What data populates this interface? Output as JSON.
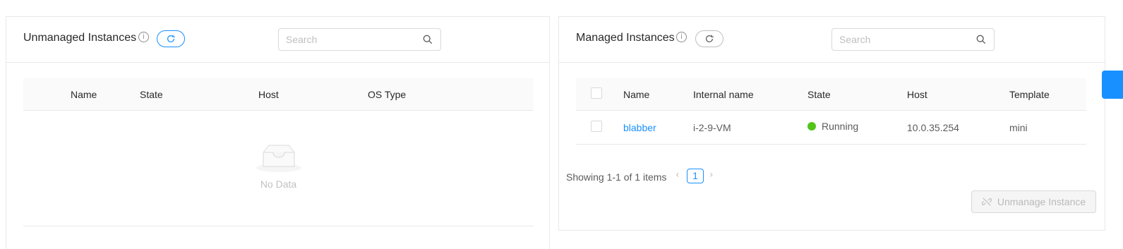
{
  "unmanaged": {
    "title": "Unmanaged Instances",
    "info_icon": "info-circle-icon",
    "refresh_icon": "reload-icon",
    "search_placeholder": "Search",
    "columns": [
      "Name",
      "State",
      "Host",
      "OS Type"
    ],
    "empty_text": "No Data",
    "empty_icon": "inbox-icon"
  },
  "managed": {
    "title": "Managed Instances",
    "info_icon": "info-circle-icon",
    "refresh_icon": "reload-icon",
    "search_placeholder": "Search",
    "columns": [
      "Name",
      "Internal name",
      "State",
      "Host",
      "Template"
    ],
    "rows": [
      {
        "name": "blabber",
        "internal_name": "i-2-9-VM",
        "state": "Running",
        "host": "10.0.35.254",
        "template": "mini"
      }
    ],
    "pagination": {
      "summary": "Showing 1-1 of 1 items",
      "prev": "‹",
      "next": "›",
      "current_page": "1"
    },
    "unmanage_button": "Unmanage Instance",
    "unmanage_icon": "disconnect-icon"
  },
  "colors": {
    "accent": "#1890ff",
    "running": "#52c41a",
    "border": "#e8e8e8",
    "header_bg": "#fafafa"
  }
}
